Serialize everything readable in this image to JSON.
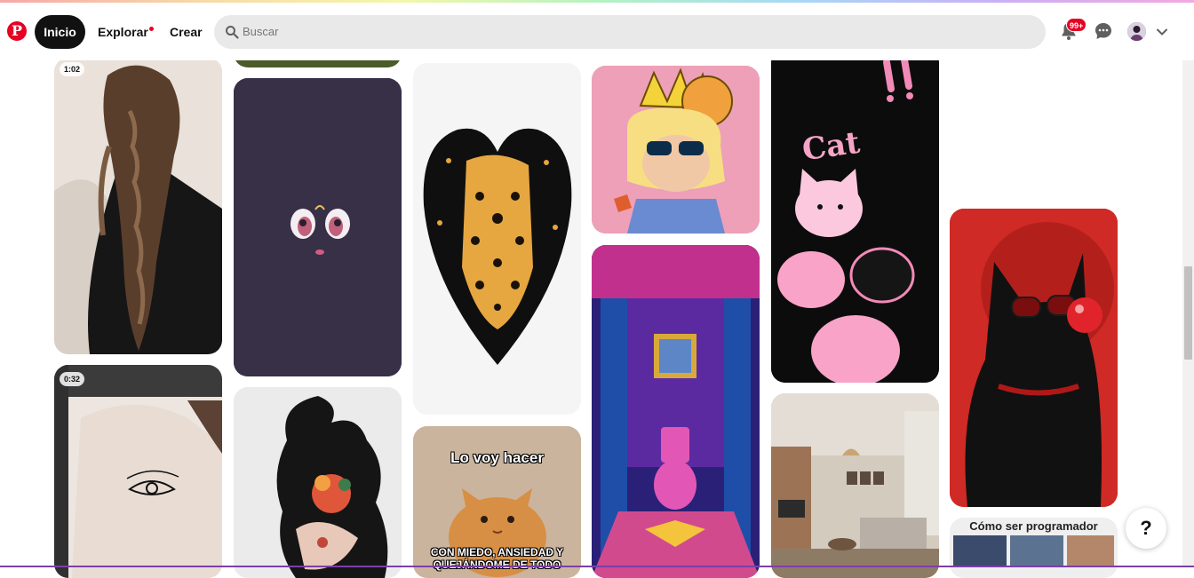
{
  "header": {
    "nav_home": "Inicio",
    "nav_explore": "Explorar",
    "nav_create": "Crear",
    "search_placeholder": "Buscar",
    "notifications_badge": "99+"
  },
  "pins": [
    {
      "id": "braid-hair-video",
      "duration": "1:02"
    },
    {
      "id": "photoshop-eye-tutorial",
      "duration": "0:32"
    },
    {
      "id": "cat-moon-face"
    },
    {
      "id": "leopard-heart"
    },
    {
      "id": "crowned-kid-cartoon"
    },
    {
      "id": "pink-cats-poster",
      "text": "Cat"
    },
    {
      "id": "black-cat-red-glasses"
    },
    {
      "id": "pink-bathroom"
    },
    {
      "id": "tattoo-cat-woman"
    },
    {
      "id": "cat-meme",
      "top_text": "Lo voy hacer",
      "bottom_text": "CON MIEDO, ANSIEDAD Y QUEJÁNDOME DE TODO"
    },
    {
      "id": "living-room"
    },
    {
      "id": "programmer-meme",
      "text": "Cómo ser programador"
    }
  ],
  "help_label": "?",
  "colors": {
    "brand": "#e60023",
    "active_nav": "#111111"
  },
  "icons": [
    "pinterest-logo-icon",
    "search-icon",
    "bell-icon",
    "chat-icon",
    "chevron-down-icon"
  ]
}
